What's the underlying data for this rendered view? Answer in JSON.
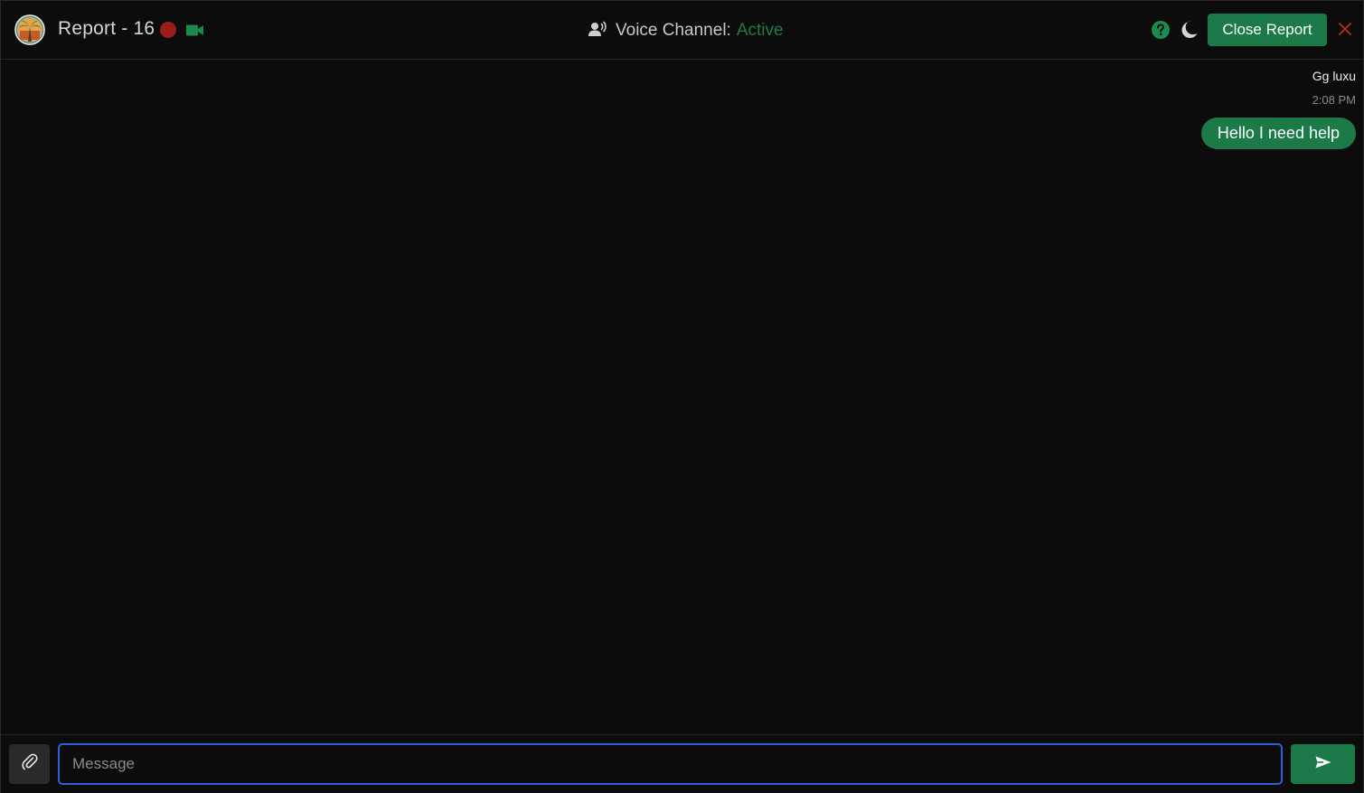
{
  "header": {
    "logo_icon": "palm-tree-logo-icon",
    "title": "Report - 16",
    "recording_indicator_color": "#9b1c1c",
    "video_icon": "video-camera-icon",
    "voice_icon": "speaking-person-icon",
    "voice_label": "Voice Channel:",
    "voice_status": "Active",
    "help_icon": "help-circle-icon",
    "theme_icon": "moon-icon",
    "close_report_label": "Close Report",
    "close_icon": "close-icon"
  },
  "messages": [
    {
      "author": "Gg luxu",
      "time": "2:08 PM",
      "text": "Hello I need help"
    }
  ],
  "composer": {
    "attach_icon": "paperclip-icon",
    "placeholder": "Message",
    "value": "",
    "send_icon": "send-icon"
  },
  "colors": {
    "accent": "#1b7a47",
    "background": "#0c0c0c",
    "input_focus": "#2f5fd8",
    "danger": "#b32424"
  }
}
